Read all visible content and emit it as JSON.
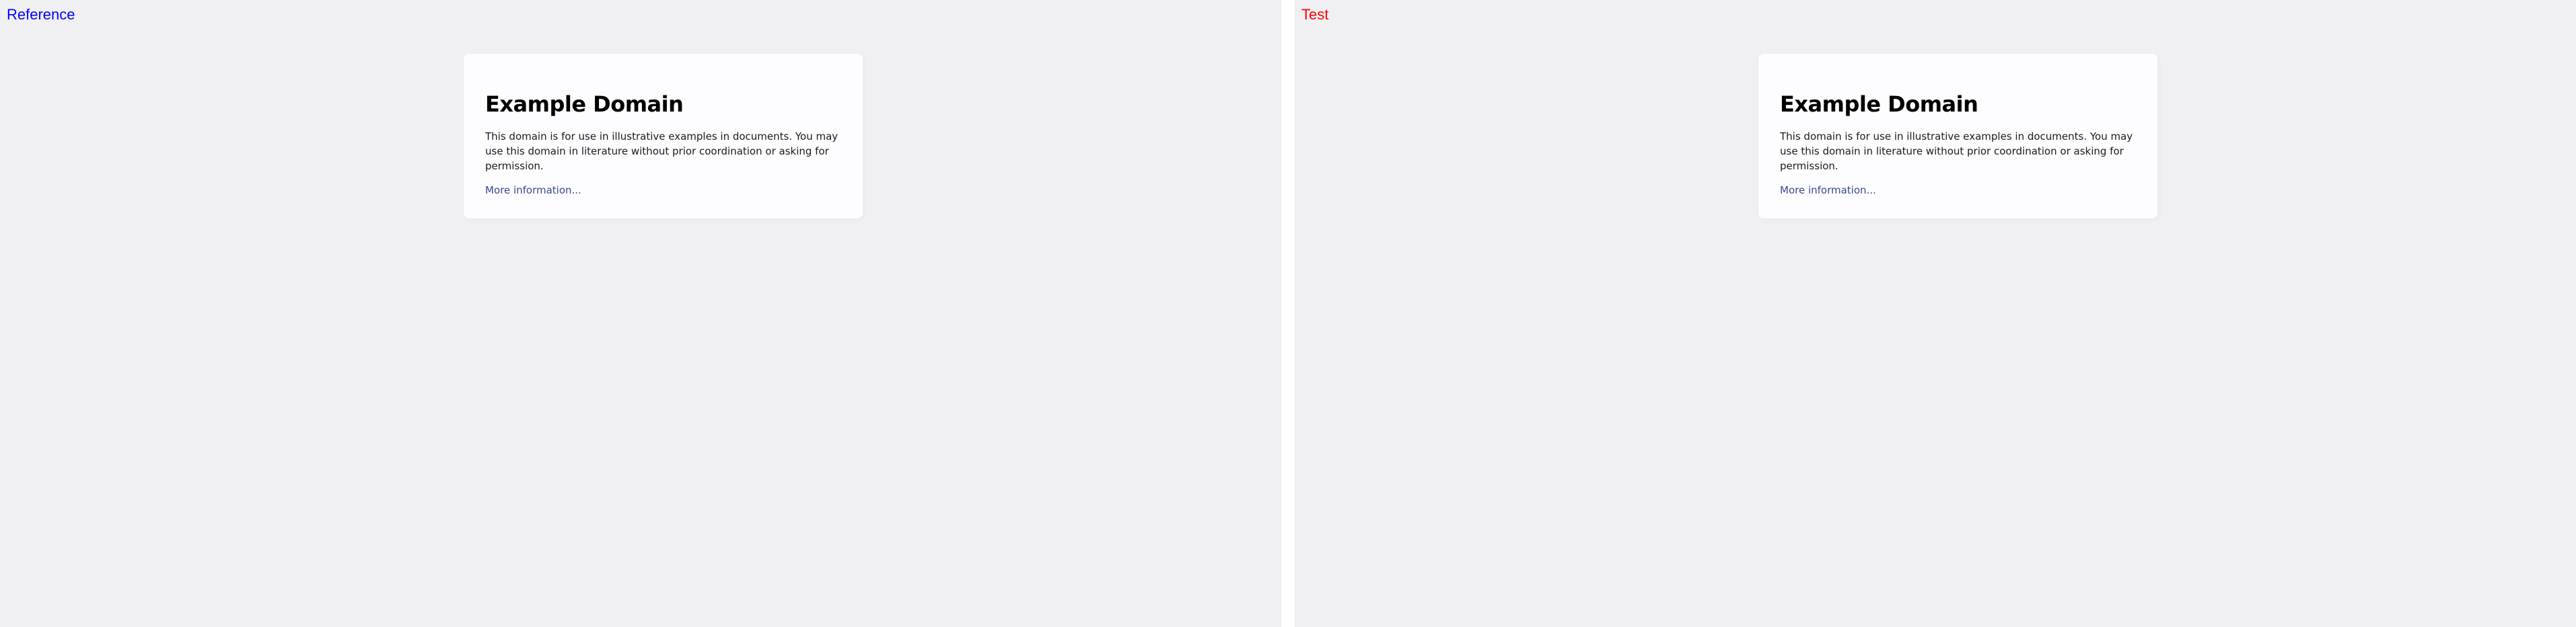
{
  "panes": {
    "reference": {
      "label": "Reference",
      "label_color": "#0000ff",
      "card": {
        "title": "Example Domain",
        "body": "This domain is for use in illustrative examples in documents. You may use this domain in literature without prior coordination or asking for permission.",
        "link": "More information..."
      }
    },
    "test": {
      "label": "Test",
      "label_color": "#ff0000",
      "card": {
        "title": "Example Domain",
        "body": "This domain is for use in illustrative examples in documents. You may use this domain in literature without prior coordination or asking for permission.",
        "link": "More information..."
      }
    }
  },
  "colors": {
    "page_background": "#f0f0f2",
    "card_background": "#fdfdff",
    "link": "#38488f"
  }
}
